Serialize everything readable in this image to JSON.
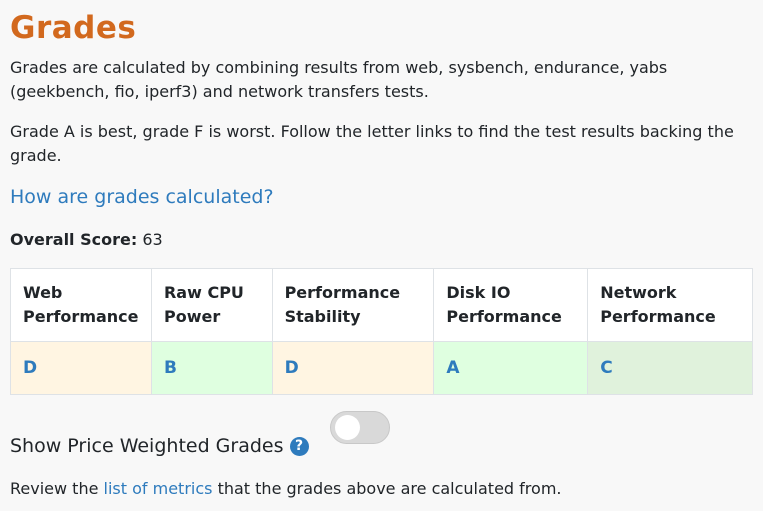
{
  "page": {
    "title": "Grades",
    "intro": "Grades are calculated by combining results from web, sysbench, endurance, yabs (geekbench, fio, iperf3) and network transfers tests.",
    "grade_scale": "Grade A is best, grade F is worst. Follow the letter links to find the test results backing the grade.",
    "how_link": "How are grades calculated?"
  },
  "overall": {
    "label": "Overall Score:",
    "value": "63"
  },
  "grades_table": {
    "headers": [
      "Web Performance",
      "Raw CPU Power",
      "Performance Stability",
      "Disk IO Performance",
      "Network Performance"
    ],
    "grades": [
      "D",
      "B",
      "D",
      "A",
      "C"
    ]
  },
  "price_toggle": {
    "label": "Show Price Weighted Grades",
    "help_icon": "question-circle-icon",
    "state": "off"
  },
  "footer": {
    "prefix": "Review the",
    "link": "list of metrics",
    "suffix": "that the grades above are calculated from."
  },
  "colors": {
    "title": "#d2691e",
    "link": "#2e7bbd",
    "grade_d_bg": "#fff5e2",
    "grade_ab_bg": "#dfffe0",
    "grade_c_bg": "#e0f2dc"
  }
}
